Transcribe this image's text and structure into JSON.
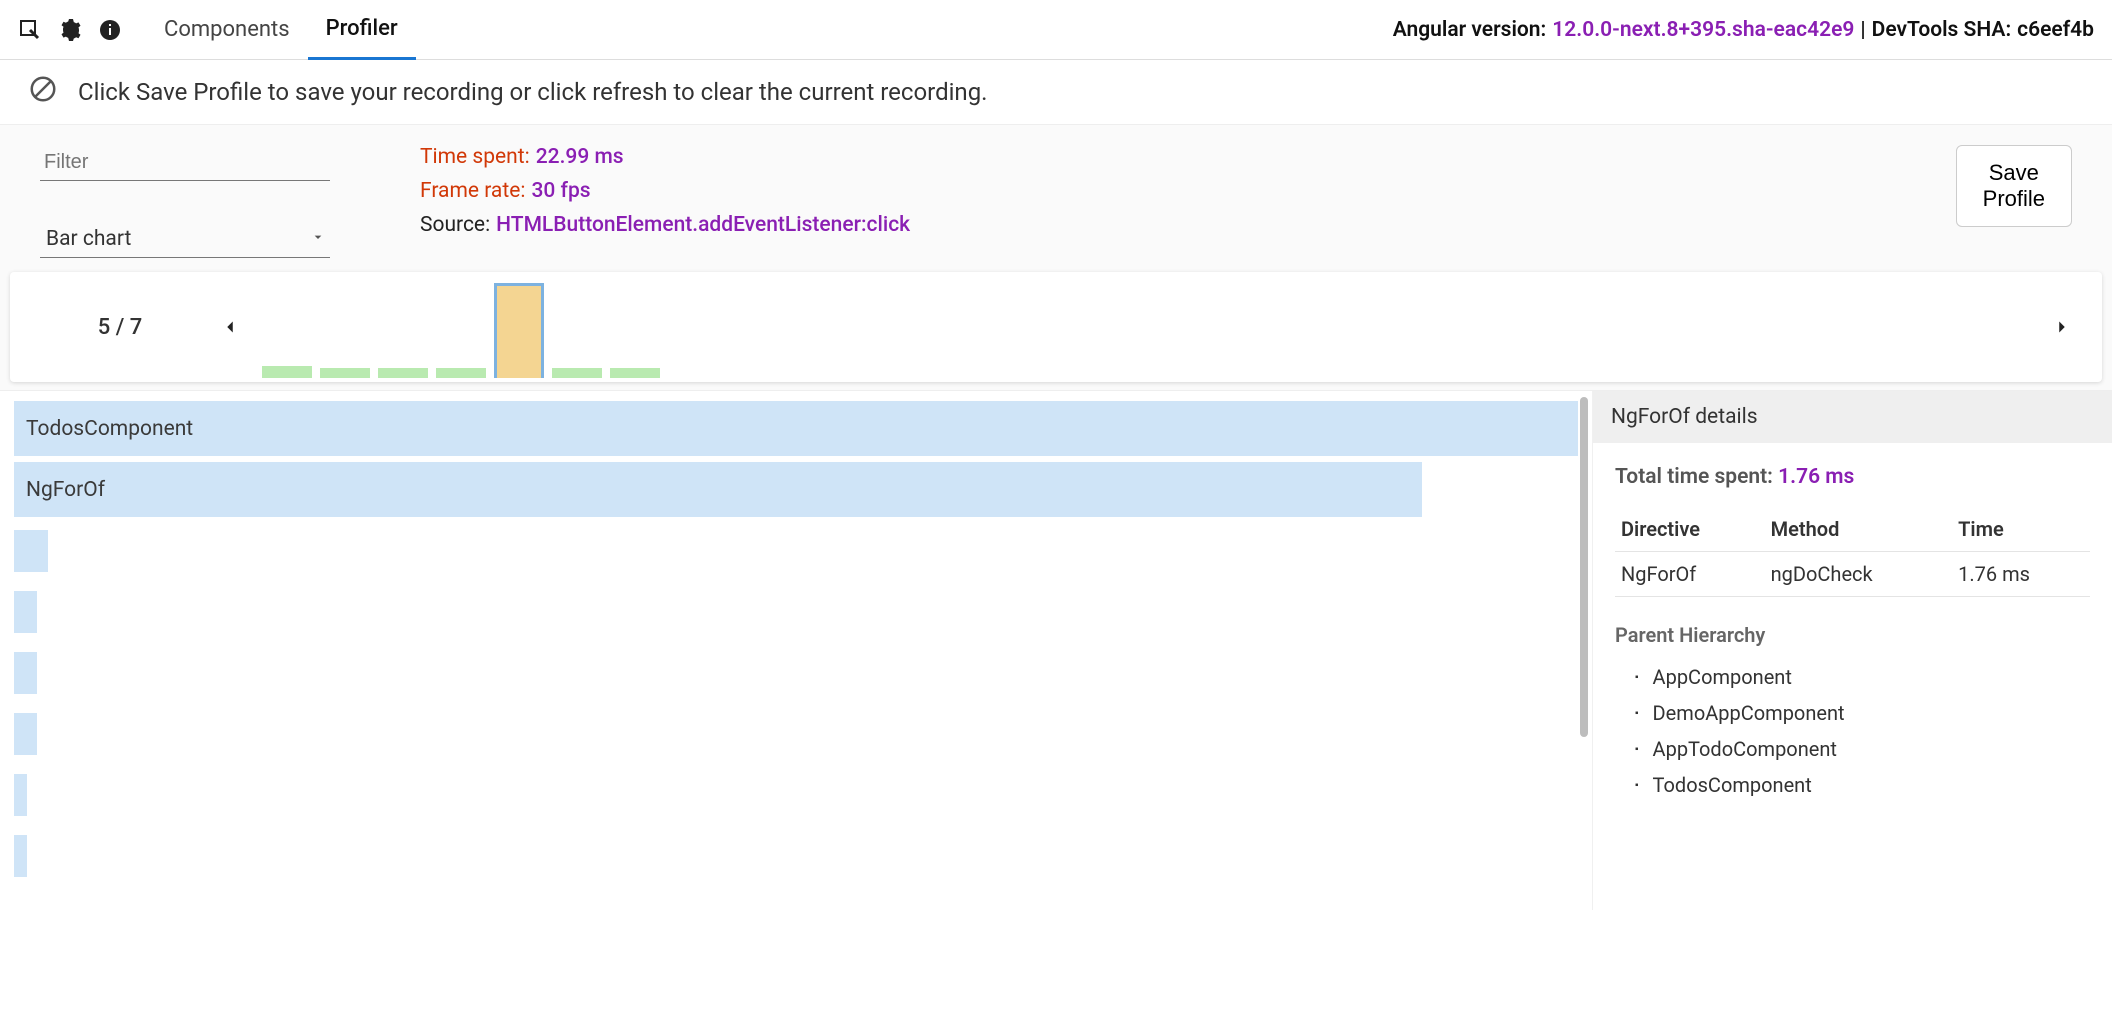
{
  "tabs": {
    "components": "Components",
    "profiler": "Profiler"
  },
  "version": {
    "ng_label": "Angular version:",
    "ng_value": "12.0.0-next.8+395.sha-eac42e9",
    "sep": " | ",
    "dt_label": "DevTools SHA:",
    "dt_value": "c6eef4b"
  },
  "hint": "Click Save Profile to save your recording or click refresh to clear the current recording.",
  "controls": {
    "filter_placeholder": "Filter",
    "chart_type": "Bar chart",
    "save_button": "Save\nProfile"
  },
  "stats": {
    "time_label": "Time spent:",
    "time_value": "22.99 ms",
    "rate_label": "Frame rate:",
    "rate_value": "30 fps",
    "source_label": "Source:",
    "source_value": "HTMLButtonElement.addEventListener:click"
  },
  "timeline": {
    "counter": "5 / 7",
    "bars": [
      {
        "h": 12,
        "selected": false
      },
      {
        "h": 10,
        "selected": false
      },
      {
        "h": 10,
        "selected": false
      },
      {
        "h": 10,
        "selected": false
      },
      {
        "h": 95,
        "selected": true
      },
      {
        "h": 10,
        "selected": false
      },
      {
        "h": 10,
        "selected": false
      }
    ]
  },
  "chart_data": {
    "type": "bar",
    "orientation": "horizontal",
    "title": "",
    "rows": [
      {
        "label": "TodosComponent",
        "widthPct": 100
      },
      {
        "label": "NgForOf",
        "widthPct": 90
      },
      {
        "label": "",
        "widthPct": 2.2
      },
      {
        "label": "",
        "widthPct": 1.5
      },
      {
        "label": "",
        "widthPct": 1.5
      },
      {
        "label": "",
        "widthPct": 1.5
      },
      {
        "label": "",
        "widthPct": 0.8
      },
      {
        "label": "",
        "widthPct": 0.8
      }
    ]
  },
  "details": {
    "header": "NgForOf details",
    "total_label": "Total time spent:",
    "total_value": "1.76 ms",
    "table": {
      "headers": [
        "Directive",
        "Method",
        "Time"
      ],
      "rows": [
        {
          "directive": "NgForOf",
          "method": "ngDoCheck",
          "time": "1.76 ms"
        }
      ]
    },
    "hierarchy_title": "Parent Hierarchy",
    "hierarchy": [
      "AppComponent",
      "DemoAppComponent",
      "AppTodoComponent",
      "TodosComponent"
    ]
  }
}
